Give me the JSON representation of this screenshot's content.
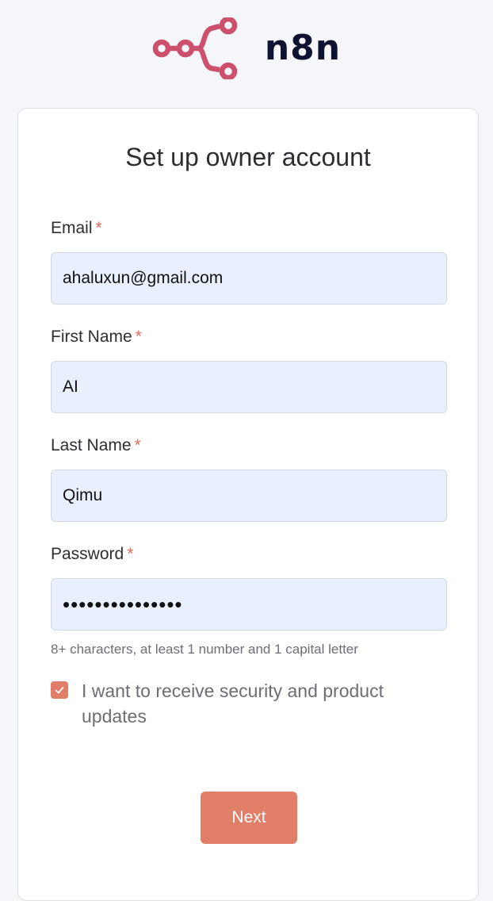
{
  "brand": {
    "name": "n8n",
    "icon": "n8n-logo-icon",
    "color": "#cc4f6b"
  },
  "form": {
    "title": "Set up owner account",
    "required_mark": "*",
    "email": {
      "label": "Email",
      "value": "ahaluxun@gmail.com"
    },
    "first_name": {
      "label": "First Name",
      "value": "AI"
    },
    "last_name": {
      "label": "Last Name",
      "value": "Qimu"
    },
    "password": {
      "label": "Password",
      "value": "•••••••••••••••",
      "hint": "8+ characters, at least 1 number and 1 capital letter"
    },
    "updates_checkbox": {
      "label": "I want to receive security and product updates",
      "checked": true
    },
    "submit_label": "Next"
  },
  "colors": {
    "accent": "#e07e68",
    "input_bg": "#e8f0fe",
    "required": "#e46c5d"
  }
}
